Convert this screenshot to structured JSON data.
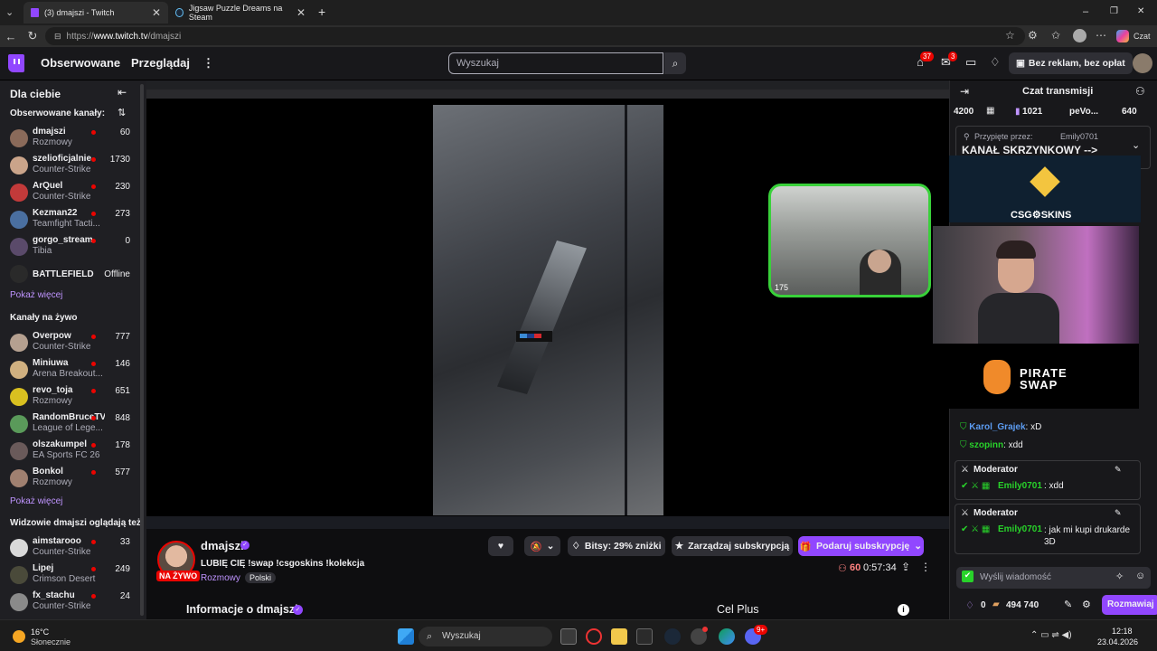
{
  "browser": {
    "tabs": [
      {
        "title": "(3) dmajszi - Twitch"
      },
      {
        "title": "Jigsaw Puzzle Dreams na Steam"
      }
    ],
    "new_tab": "+",
    "url_scheme": "https://",
    "url_domain": "www.twitch.tv",
    "url_path": "/dmajszi",
    "window_controls": {
      "minimize": "–",
      "restore": "❐",
      "close": "✕"
    },
    "copilot_label": "Czat"
  },
  "topnav": {
    "followed": "Obserwowane",
    "browse": "Przeglądaj",
    "more": "⋮",
    "search_placeholder": "Wyszukaj",
    "inbox_badge": "37",
    "whispers_badge": "3",
    "no_ads": "Bez reklam, bez opłat"
  },
  "sidebar": {
    "title": "Dla ciebie",
    "followed_header": "Obserwowane kanały:",
    "followed": [
      {
        "name": "dmajszi",
        "category": "Rozmowy",
        "viewers": "60",
        "color": "#8a6a5a"
      },
      {
        "name": "szelioficjalnie",
        "category": "Counter-Strike",
        "viewers": "1730",
        "color": "#caa48a"
      },
      {
        "name": "ArQuel",
        "category": "Counter-Strike",
        "viewers": "230",
        "color": "#c23a3a"
      },
      {
        "name": "Kezman22",
        "category": "Teamfight Tacti...",
        "viewers": "273",
        "color": "#4a6fa0"
      },
      {
        "name": "gorgo_stream",
        "category": "Tibia",
        "viewers": "0",
        "color": "#5a4a6a"
      },
      {
        "name": "BATTLEFIELD",
        "category": "",
        "viewers": "Offline",
        "color": "#2a2a2a"
      }
    ],
    "show_more_1": "Pokaż więcej",
    "live_header": "Kanały na żywo",
    "live": [
      {
        "name": "Overpow",
        "category": "Counter-Strike",
        "viewers": "777",
        "color": "#b5a090"
      },
      {
        "name": "Miniuwa",
        "category": "Arena Breakout...",
        "viewers": "146",
        "color": "#d0b080"
      },
      {
        "name": "revo_toja",
        "category": "Rozmowy",
        "viewers": "651",
        "color": "#d9c020"
      },
      {
        "name": "RandomBruceTV",
        "category": "League of Lege...",
        "viewers": "848",
        "color": "#5a9a5a"
      },
      {
        "name": "olszakumpel",
        "category": "EA Sports FC 26",
        "viewers": "178",
        "color": "#6a5a5a"
      },
      {
        "name": "Bonkol",
        "category": "Rozmowy",
        "viewers": "577",
        "color": "#a08070"
      }
    ],
    "show_more_2": "Pokaż więcej",
    "also_header": "Widzowie dmajszi oglądają też:",
    "also": [
      {
        "name": "aimstarooo",
        "category": "Counter-Strike",
        "viewers": "33",
        "color": "#d9d9d9"
      },
      {
        "name": "Lipej",
        "category": "Crimson Desert",
        "viewers": "249",
        "color": "#4a4a3a"
      },
      {
        "name": "fx_stachu",
        "category": "Counter-Strike",
        "viewers": "24",
        "color": "#8a8a8a"
      }
    ]
  },
  "player": {
    "webcam_count": "175"
  },
  "stream_info": {
    "streamer": "dmajszi",
    "live_label": "NA ŻYWO",
    "title": "LUBIĘ CIĘ !swap !csgoskins !kolekcja",
    "category": "Rozmowy",
    "language_tag": "Polski",
    "bitsy": "Bitsy: 29% zniżki",
    "manage_sub": "Zarządzaj subskrypcją",
    "gift_sub": "Podaruj subskrypcję",
    "viewers": "60",
    "uptime": "0:57:34",
    "about": "Informacje o dmajszi",
    "panel_title": "Cel Plus"
  },
  "chat": {
    "header": "Czat transmisji",
    "leaderboard": [
      {
        "value": "4200"
      },
      {
        "value": "1021"
      },
      {
        "value": "peVo..."
      },
      {
        "value": "640"
      }
    ],
    "pinned_by_label": "Przypięte przez:",
    "pinned_by": "Emily0701",
    "pinned_text": "KANAŁ SKRZYNKOWY -->",
    "csg_label": "CSG⚙SKINS",
    "pirate_label": "PIRATE SWAP",
    "messages": [
      {
        "user": "Karol_Grajek",
        "text": ": xD",
        "color": "#5c9cf2"
      },
      {
        "user": "szopinn",
        "text": ": xdd",
        "color": "#28d22a"
      }
    ],
    "mod_messages": [
      {
        "role": "Moderator",
        "user": "Emily0701",
        "text": ": xdd"
      },
      {
        "role": "Moderator",
        "user": "Emily0701",
        "text": ": jak mi kupi drukarde 3D"
      }
    ],
    "input_placeholder": "Wyślij wiadomość",
    "points_zero": "0",
    "points": "494 740",
    "send": "Rozmawiaj"
  },
  "taskbar": {
    "weather_temp": "16°C",
    "weather_desc": "Słonecznie",
    "search": "Wyszukaj",
    "time": "12:18",
    "date": "23.04.2026",
    "notif_badge": "9+"
  }
}
